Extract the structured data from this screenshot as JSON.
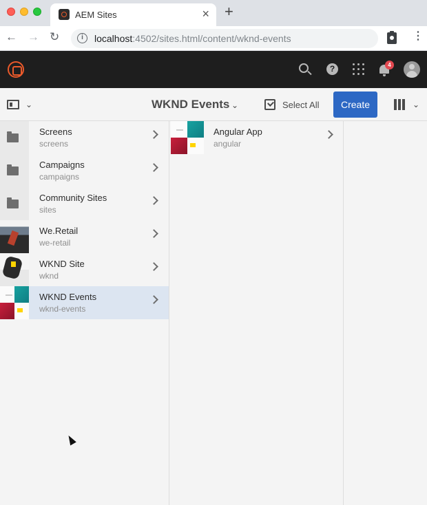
{
  "browser": {
    "tab": {
      "title": "AEM Sites",
      "close": "×"
    },
    "new_tab": "+",
    "nav": {
      "back": "←",
      "forward": "→",
      "reload": "↻"
    },
    "url": {
      "host": "localhost",
      "rest": ":4502/sites.html/content/wknd-events"
    },
    "menu": "⋮"
  },
  "shell": {
    "notifications_count": "4"
  },
  "actionbar": {
    "title": "WKND Events",
    "select_all": "Select All",
    "create": "Create"
  },
  "columns": {
    "sites": [
      {
        "title": "Screens",
        "subtitle": "screens",
        "thumb": "folder-icon"
      },
      {
        "title": "Campaigns",
        "subtitle": "campaigns",
        "thumb": "folder-icon"
      },
      {
        "title": "Community Sites",
        "subtitle": "sites",
        "thumb": "folder-icon"
      },
      {
        "title": "We.Retail",
        "subtitle": "we-retail",
        "thumb": "we-retail-thumbnail"
      },
      {
        "title": "WKND Site",
        "subtitle": "wknd",
        "thumb": "wknd-thumbnail"
      },
      {
        "title": "WKND Events",
        "subtitle": "wknd-events",
        "thumb": "wknd-events-thumbnail",
        "selected": true
      }
    ],
    "children": [
      {
        "title": "Angular App",
        "subtitle": "angular",
        "thumb": "wknd-events-thumbnail"
      }
    ]
  },
  "colors": {
    "shell_bg": "#1e1e1e",
    "accent": "#2d68c4",
    "selected_row": "#dce5f1",
    "badge": "#e34850",
    "logo": "#eb5a2b"
  }
}
